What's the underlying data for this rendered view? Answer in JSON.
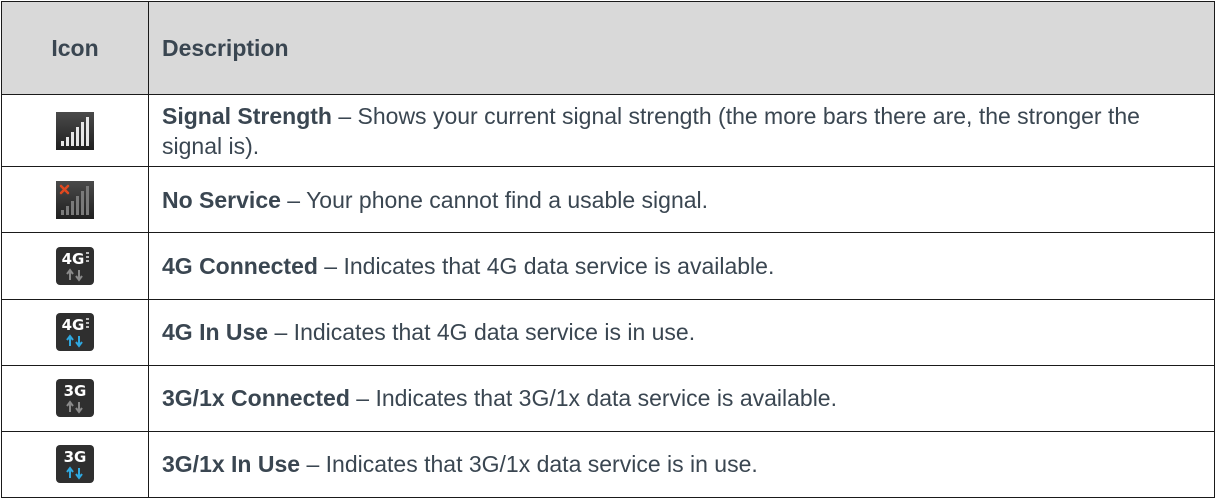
{
  "table": {
    "headers": {
      "icon": "Icon",
      "description": "Description"
    },
    "rows": [
      {
        "icon": "signal-strength-icon",
        "term": "Signal Strength",
        "text": " – Shows your current signal strength (the more bars there are, the stronger the signal is)."
      },
      {
        "icon": "no-service-icon",
        "term": "No Service",
        "text": " – Your phone cannot find a usable signal."
      },
      {
        "icon": "4g-connected-icon",
        "term": "4G Connected",
        "text": " – Indicates that 4G data service is available."
      },
      {
        "icon": "4g-in-use-icon",
        "term": "4G In Use",
        "text": " – Indicates that 4G data service is in use."
      },
      {
        "icon": "3g-connected-icon",
        "term": "3G/1x Connected",
        "text": " – Indicates that 3G/1x data service is available."
      },
      {
        "icon": "3g-in-use-icon",
        "term": "3G/1x In Use",
        "text": " – Indicates that 3G/1x data service is in use."
      }
    ]
  },
  "colors": {
    "header_bg": "#d9d9d9",
    "text": "#3a4651",
    "border": "#1a1a1a",
    "icon_bg": "#2f2f2f",
    "arrow_active": "#2fa8e0",
    "arrow_idle": "#8a8a8a",
    "no_service_x": "#e0481f"
  }
}
